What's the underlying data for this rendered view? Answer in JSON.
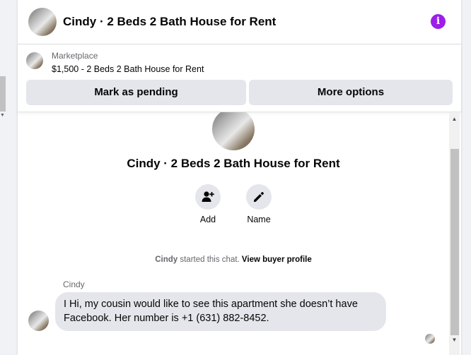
{
  "header": {
    "title": "Cindy · 2 Beds 2 Bath House for Rent",
    "info_icon": "i"
  },
  "listing": {
    "source_label": "Marketplace",
    "price_title": "$1,500 - 2 Beds 2 Bath House for Rent",
    "mark_pending_label": "Mark as pending",
    "more_options_label": "More options"
  },
  "profile": {
    "title": "Cindy · 2 Beds 2 Bath House for Rent",
    "actions": [
      {
        "label": "Add",
        "icon": "add-person-icon"
      },
      {
        "label": "Name",
        "icon": "pencil-icon"
      }
    ]
  },
  "chat": {
    "started_who": "Cindy",
    "started_text": " started this chat. ",
    "view_profile_link": "View buyer profile",
    "messages": [
      {
        "sender": "Cindy",
        "text": "I Hi, my cousin would like to see this apartment she doesn’t have Facebook. Her number is +1 (631) 882-8452."
      }
    ]
  },
  "colors": {
    "accent": "#9b1fe8",
    "button_bg": "#e4e6eb",
    "secondary_text": "#65676b"
  }
}
